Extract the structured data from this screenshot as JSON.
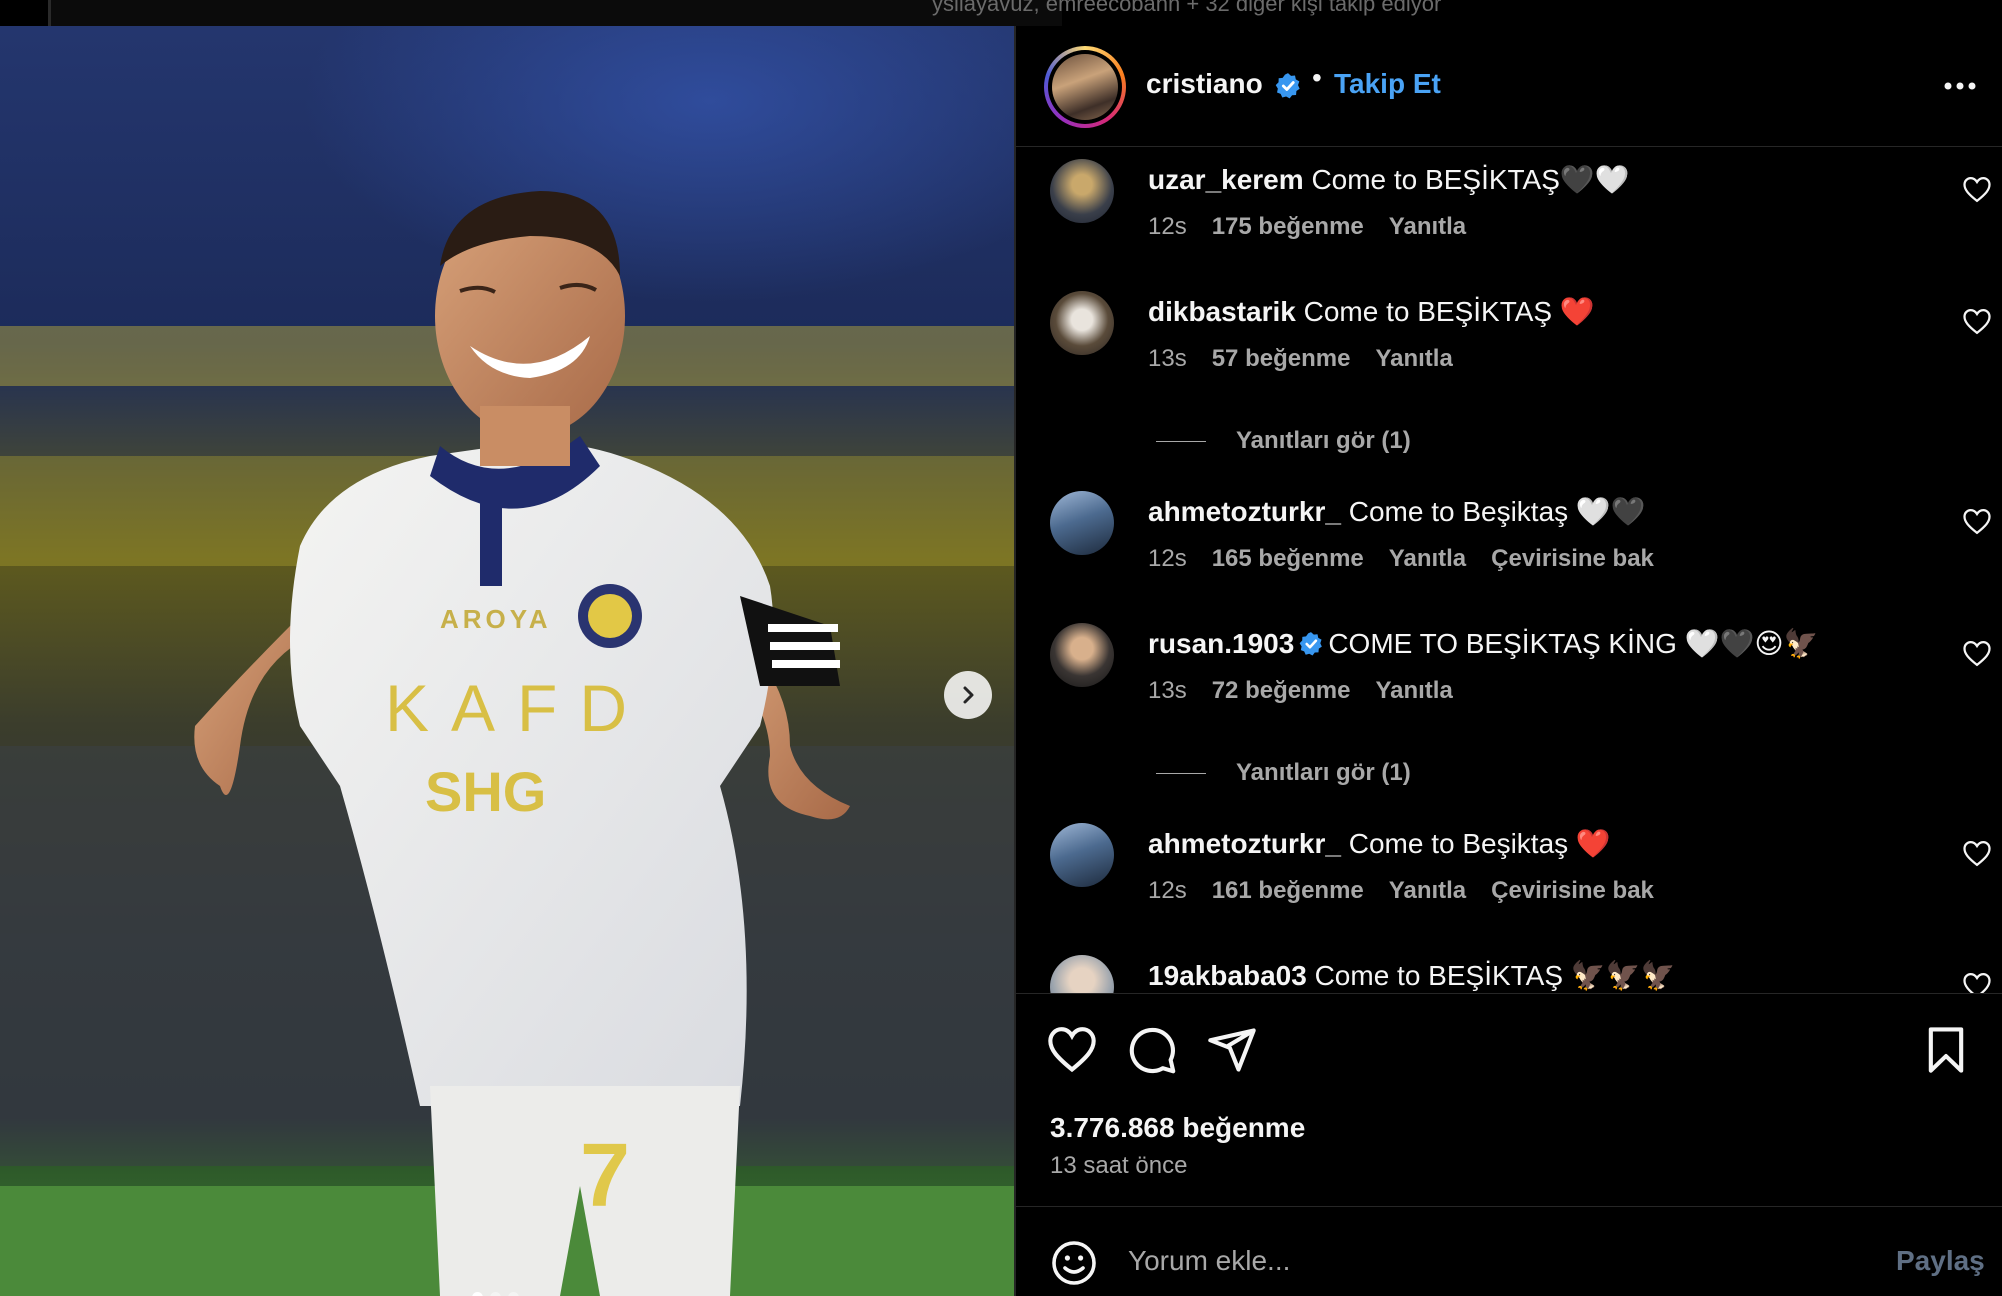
{
  "top_strip": {
    "follow_note": "ysilayavuz, emreecobann + 32 diğer kişi takip ediyor"
  },
  "post": {
    "author": "cristiano",
    "follow_label": "Takip Et",
    "separator": "•",
    "jersey_text": {
      "sponsor": "KAFD",
      "sub_sponsor": "SHG",
      "brand": "AROYA",
      "number": "7"
    },
    "carousel": {
      "total": 3,
      "active": 0
    }
  },
  "comments": [
    {
      "user": "uzar_kerem",
      "verified": false,
      "text": "Come to BEŞİKTAŞ🖤🤍",
      "time": "12s",
      "likes": "175 beğenme",
      "reply": "Yanıtla",
      "translate": ""
    },
    {
      "user": "dikbastarik",
      "verified": false,
      "text": "Come to BEŞİKTAŞ ❤️",
      "time": "13s",
      "likes": "57 beğenme",
      "reply": "Yanıtla",
      "translate": "",
      "view_replies": "Yanıtları gör (1)"
    },
    {
      "user": "ahmetozturkr_",
      "verified": false,
      "text": "Come to Beşiktaş 🤍🖤",
      "time": "12s",
      "likes": "165 beğenme",
      "reply": "Yanıtla",
      "translate": "Çevirisine bak"
    },
    {
      "user": "rusan.1903",
      "verified": true,
      "text": "COME TO BEŞİKTAŞ KİNG 🤍🖤😍🦅",
      "time": "13s",
      "likes": "72 beğenme",
      "reply": "Yanıtla",
      "translate": "",
      "view_replies": "Yanıtları gör (1)"
    },
    {
      "user": "ahmetozturkr_",
      "verified": false,
      "text": "Come to Beşiktaş ❤️",
      "time": "12s",
      "likes": "161 beğenme",
      "reply": "Yanıtla",
      "translate": "Çevirisine bak"
    },
    {
      "user": "19akbaba03",
      "verified": false,
      "text": "Come to BEŞİKTAŞ 🦅🦅🦅",
      "time": "",
      "likes": "",
      "reply": "",
      "translate": ""
    }
  ],
  "stats": {
    "likes": "3.776.868 beğenme",
    "time_ago": "13 saat önce"
  },
  "composer": {
    "placeholder": "Yorum ekle...",
    "share_label": "Paylaş"
  },
  "colors": {
    "link_blue": "#4aa3f5",
    "verified_blue": "#3897f0",
    "muted": "#a8a8a8",
    "divider": "#262626"
  },
  "icons": [
    "heart-icon",
    "comment-icon",
    "share-icon",
    "bookmark-icon",
    "emoji-icon",
    "more-icon",
    "chevron-right-icon",
    "verified-icon"
  ]
}
